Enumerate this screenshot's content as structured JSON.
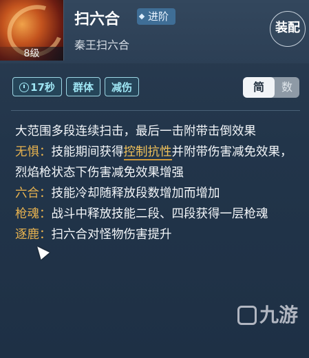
{
  "skill": {
    "name": "扫六合",
    "advance_label": "进阶",
    "subtitle": "秦王扫六合",
    "level": "8级"
  },
  "equip_label": "装配",
  "tags": {
    "cooldown": "17秒",
    "target": "群体",
    "effect": "减伤"
  },
  "mode": {
    "simple": "简",
    "numeric": "数"
  },
  "description": {
    "line1": "大范围多段连续扫击，最后一击附带击倒效果",
    "p2_key": "无惧：",
    "p2_a": "技能期间获得",
    "p2_link": "控制抗性",
    "p2_b": "并附带伤害减免效果，烈焰枪状态下伤害减免效果增强",
    "p3_key": "六合：",
    "p3_text": "技能冷却随释放段数增加而增加",
    "p4_key": "枪魂：",
    "p4_text": "战斗中释放技能二段、四段获得一层枪魂",
    "p5_key": "逐鹿：",
    "p5_text": "扫六合对怪物伤害提升"
  },
  "watermark": "九游",
  "colors": {
    "background": "#22354a",
    "tag": "#9fe6f4",
    "keyword": "#e7b24f",
    "advance_badge": "#3f6e96"
  }
}
